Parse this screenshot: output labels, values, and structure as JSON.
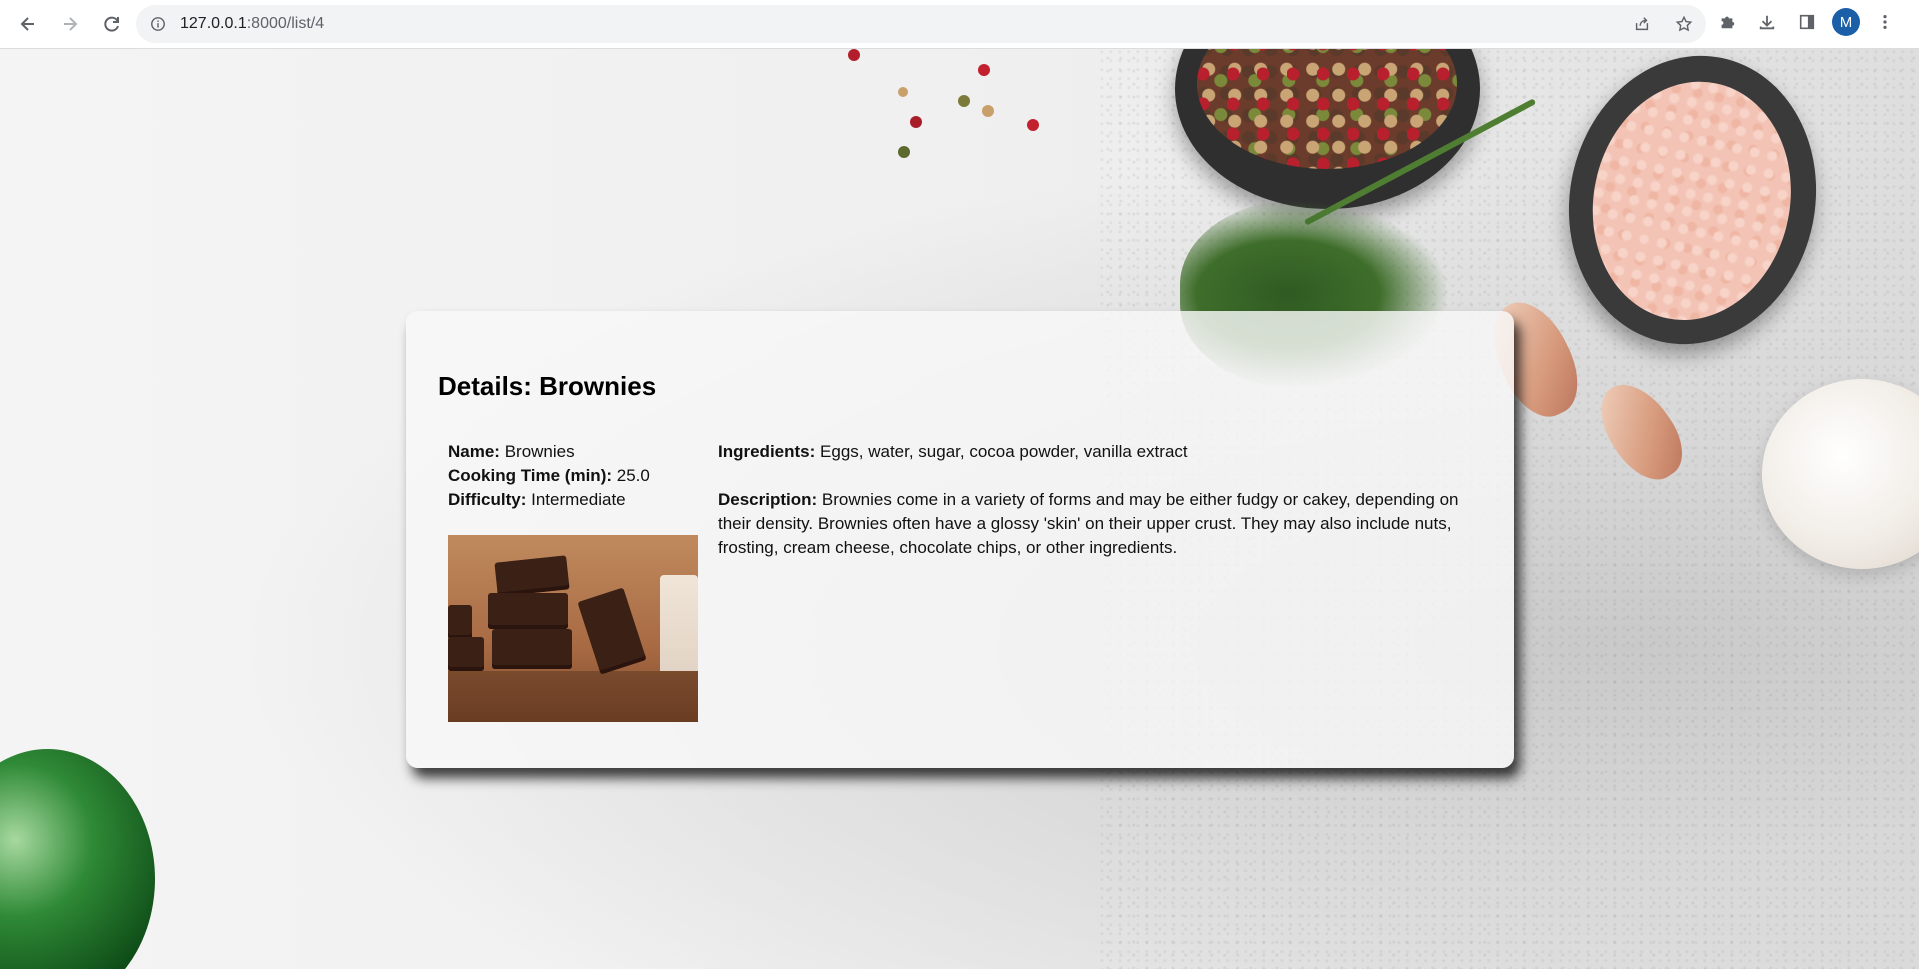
{
  "browser": {
    "url_host": "127.0.0.1",
    "url_path": ":8000/list/4",
    "profile_initial": "M"
  },
  "details": {
    "heading": "Details: Brownies",
    "name_label": "Name:",
    "name_value": "Brownies",
    "cooking_time_label": "Cooking Time (min):",
    "cooking_time_value": "25.0",
    "difficulty_label": "Difficulty:",
    "difficulty_value": "Intermediate",
    "ingredients_label": "Ingredients:",
    "ingredients_value": "Eggs, water, sugar, cocoa powder, vanilla extract",
    "description_label": "Description:",
    "description_value": "Brownies come in a variety of forms and may be either fudgy or cakey, depending on their density. Brownies often have a glossy 'skin' on their upper crust. They may also include nuts, frosting, cream cheese, chocolate chips, or other ingredients."
  },
  "icons": {
    "back": "back-arrow-icon",
    "forward": "forward-arrow-icon",
    "reload": "reload-icon",
    "site_info": "info-icon",
    "share": "share-icon",
    "bookmark": "star-icon",
    "extensions": "puzzle-icon",
    "downloads": "download-icon",
    "side_panel": "side-panel-icon",
    "menu": "kebab-menu-icon"
  },
  "colors": {
    "avatar": "#1a5fa8",
    "omnibox": "#f1f3f4"
  }
}
